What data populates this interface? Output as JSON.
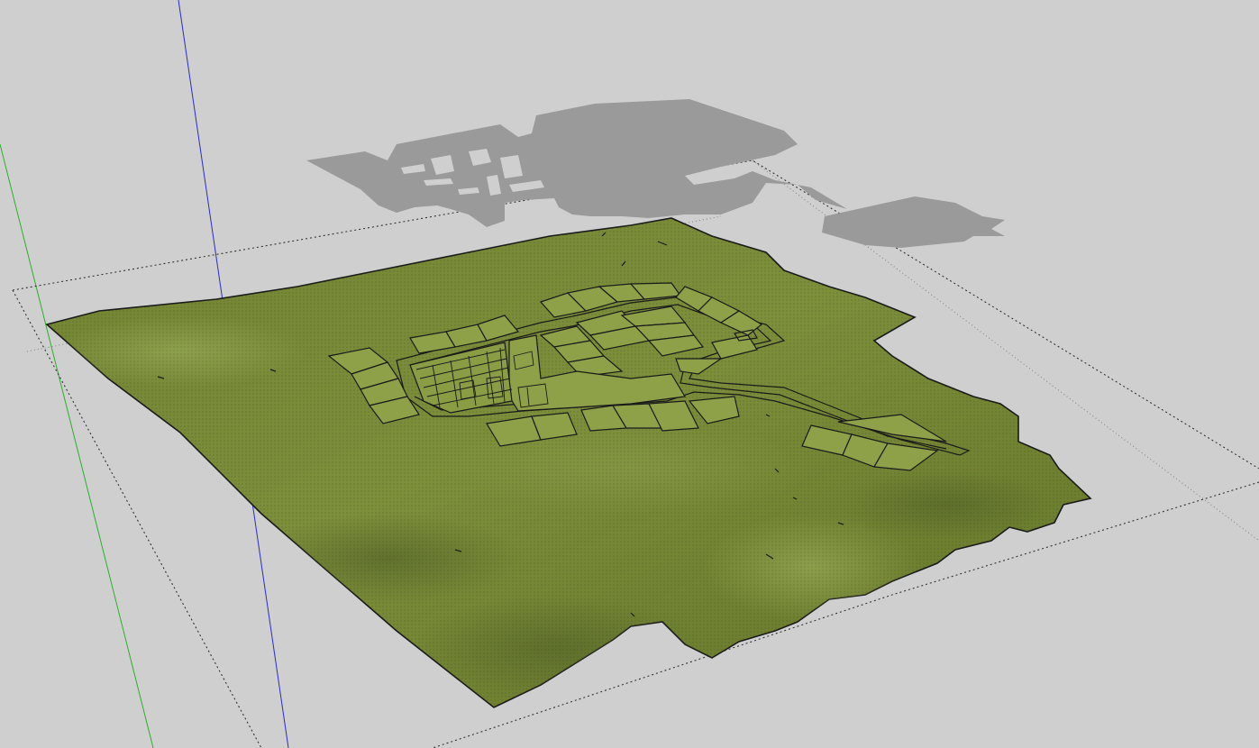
{
  "app": {
    "view": "3d-model-viewport"
  },
  "colors": {
    "background": "#cfcfcf",
    "terrain": "#7a8c3a",
    "terrain_dark": "#5f6f2a",
    "terrain_light": "#93a652",
    "parcel": "#8ea149",
    "shadow": "#9a9a9a",
    "axis_blue": "#2a2ad0",
    "axis_green": "#2ab02a",
    "edge": "#1a1a1a",
    "bounds": "#333333"
  },
  "scene": {
    "objects": [
      "terrain-mesh",
      "site-plan-parcels",
      "road-network",
      "shadow-projection",
      "bounding-box"
    ],
    "axes": [
      "blue-axis",
      "green-axis"
    ]
  }
}
